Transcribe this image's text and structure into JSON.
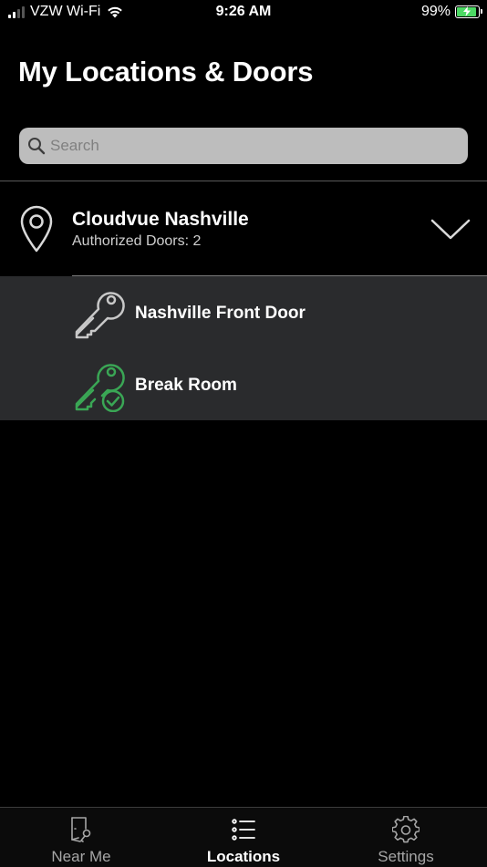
{
  "status_bar": {
    "carrier": "VZW Wi-Fi",
    "time": "9:26 AM",
    "battery_percent": "99%",
    "battery_color": "#4cd964"
  },
  "page": {
    "title": "My Locations & Doors"
  },
  "search": {
    "placeholder": "Search",
    "value": ""
  },
  "location": {
    "name": "Cloudvue Nashville",
    "subtitle": "Authorized Doors: 2",
    "icon": "map-pin-icon",
    "expanded": true
  },
  "doors": [
    {
      "label": "Nashville Front Door",
      "icon": "key-icon",
      "status": "default",
      "color": "#c8c8c8"
    },
    {
      "label": "Break Room",
      "icon": "key-check-icon",
      "status": "authorized",
      "color": "#3aa655"
    }
  ],
  "tabs": [
    {
      "label": "Near Me",
      "icon": "door-key-icon",
      "active": false
    },
    {
      "label": "Locations",
      "icon": "list-icon",
      "active": true
    },
    {
      "label": "Settings",
      "icon": "gear-icon",
      "active": false
    }
  ]
}
